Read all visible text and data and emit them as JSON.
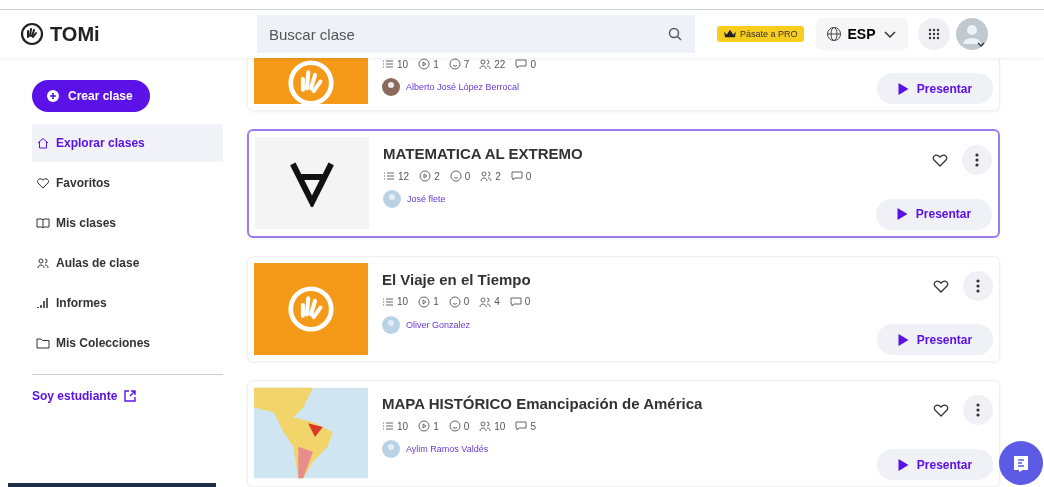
{
  "header": {
    "logo_text": "TOMi",
    "search": {
      "placeholder": "Buscar clase"
    },
    "pro_button": "Pásate a PRO",
    "language": "ESP"
  },
  "sidebar": {
    "create_button": "Crear clase",
    "items": [
      {
        "label": "Explorar clases",
        "selected": true
      },
      {
        "label": "Favoritos",
        "selected": false
      },
      {
        "label": "Mis clases",
        "selected": false
      },
      {
        "label": "Aulas de clase",
        "selected": false
      },
      {
        "label": "Informes",
        "selected": false
      },
      {
        "label": "Mis Colecciones",
        "selected": false
      }
    ],
    "student_link": "Soy estudiante"
  },
  "classes": [
    {
      "kind": "logo",
      "selected": false,
      "author": "Alberto José López Berrocal",
      "stats": [
        {
          "kind": "lessons",
          "value": "10"
        },
        {
          "kind": "slides",
          "value": "1"
        },
        {
          "kind": "reactions",
          "value": "7"
        },
        {
          "kind": "students",
          "value": "22"
        },
        {
          "kind": "comments",
          "value": "0"
        }
      ],
      "button": "Presentar"
    },
    {
      "title": "MATEMATICA AL EXTREMO",
      "kind": "symbol",
      "selected": true,
      "author": "José flete",
      "stats": [
        {
          "kind": "lessons",
          "value": "12"
        },
        {
          "kind": "slides",
          "value": "2"
        },
        {
          "kind": "reactions",
          "value": "0"
        },
        {
          "kind": "students",
          "value": "2"
        },
        {
          "kind": "comments",
          "value": "0"
        }
      ],
      "button": "Presentar"
    },
    {
      "title": "El Viaje en el Tiempo",
      "kind": "logo",
      "selected": false,
      "author": "Oliver Gonzalez",
      "stats": [
        {
          "kind": "lessons",
          "value": "10"
        },
        {
          "kind": "slides",
          "value": "1"
        },
        {
          "kind": "reactions",
          "value": "0"
        },
        {
          "kind": "students",
          "value": "4"
        },
        {
          "kind": "comments",
          "value": "0"
        }
      ],
      "button": "Presentar"
    },
    {
      "title": "MAPA HISTÓRICO Emancipación de América",
      "kind": "map",
      "selected": false,
      "author": "Aylim Ramos Valdés",
      "stats": [
        {
          "kind": "lessons",
          "value": "10"
        },
        {
          "kind": "slides",
          "value": "1"
        },
        {
          "kind": "reactions",
          "value": "0"
        },
        {
          "kind": "students",
          "value": "10"
        },
        {
          "kind": "comments",
          "value": "5"
        }
      ],
      "button": "Presentar"
    }
  ]
}
